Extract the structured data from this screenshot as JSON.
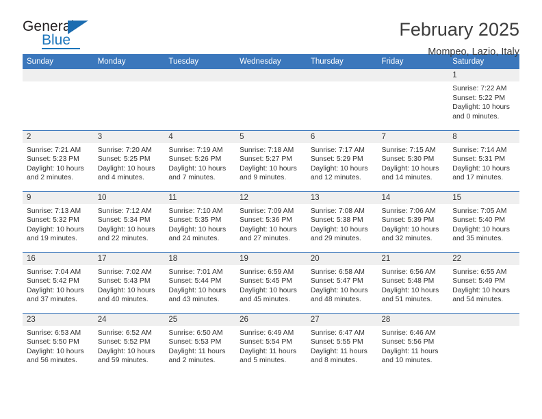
{
  "brand": {
    "name_top": "General",
    "name_bottom": "Blue",
    "accent_color": "#1b75bb",
    "triangle_icon": "triangle-icon"
  },
  "header": {
    "title": "February 2025",
    "location": "Mompeo, Lazio, Italy"
  },
  "theme": {
    "header_blue": "#3b77bc",
    "daynum_gray": "#efefef",
    "text": "#333333"
  },
  "weekday_headers": [
    "Sunday",
    "Monday",
    "Tuesday",
    "Wednesday",
    "Thursday",
    "Friday",
    "Saturday"
  ],
  "labels": {
    "sunrise": "Sunrise:",
    "sunset": "Sunset:",
    "daylight": "Daylight:"
  },
  "weeks": [
    [
      {
        "day": "",
        "blank": true
      },
      {
        "day": "",
        "blank": true
      },
      {
        "day": "",
        "blank": true
      },
      {
        "day": "",
        "blank": true
      },
      {
        "day": "",
        "blank": true
      },
      {
        "day": "",
        "blank": true
      },
      {
        "day": "1",
        "sunrise": "Sunrise: 7:22 AM",
        "sunset": "Sunset: 5:22 PM",
        "daylight": "Daylight: 10 hours and 0 minutes."
      }
    ],
    [
      {
        "day": "2",
        "sunrise": "Sunrise: 7:21 AM",
        "sunset": "Sunset: 5:23 PM",
        "daylight": "Daylight: 10 hours and 2 minutes."
      },
      {
        "day": "3",
        "sunrise": "Sunrise: 7:20 AM",
        "sunset": "Sunset: 5:25 PM",
        "daylight": "Daylight: 10 hours and 4 minutes."
      },
      {
        "day": "4",
        "sunrise": "Sunrise: 7:19 AM",
        "sunset": "Sunset: 5:26 PM",
        "daylight": "Daylight: 10 hours and 7 minutes."
      },
      {
        "day": "5",
        "sunrise": "Sunrise: 7:18 AM",
        "sunset": "Sunset: 5:27 PM",
        "daylight": "Daylight: 10 hours and 9 minutes."
      },
      {
        "day": "6",
        "sunrise": "Sunrise: 7:17 AM",
        "sunset": "Sunset: 5:29 PM",
        "daylight": "Daylight: 10 hours and 12 minutes."
      },
      {
        "day": "7",
        "sunrise": "Sunrise: 7:15 AM",
        "sunset": "Sunset: 5:30 PM",
        "daylight": "Daylight: 10 hours and 14 minutes."
      },
      {
        "day": "8",
        "sunrise": "Sunrise: 7:14 AM",
        "sunset": "Sunset: 5:31 PM",
        "daylight": "Daylight: 10 hours and 17 minutes."
      }
    ],
    [
      {
        "day": "9",
        "sunrise": "Sunrise: 7:13 AM",
        "sunset": "Sunset: 5:32 PM",
        "daylight": "Daylight: 10 hours and 19 minutes."
      },
      {
        "day": "10",
        "sunrise": "Sunrise: 7:12 AM",
        "sunset": "Sunset: 5:34 PM",
        "daylight": "Daylight: 10 hours and 22 minutes."
      },
      {
        "day": "11",
        "sunrise": "Sunrise: 7:10 AM",
        "sunset": "Sunset: 5:35 PM",
        "daylight": "Daylight: 10 hours and 24 minutes."
      },
      {
        "day": "12",
        "sunrise": "Sunrise: 7:09 AM",
        "sunset": "Sunset: 5:36 PM",
        "daylight": "Daylight: 10 hours and 27 minutes."
      },
      {
        "day": "13",
        "sunrise": "Sunrise: 7:08 AM",
        "sunset": "Sunset: 5:38 PM",
        "daylight": "Daylight: 10 hours and 29 minutes."
      },
      {
        "day": "14",
        "sunrise": "Sunrise: 7:06 AM",
        "sunset": "Sunset: 5:39 PM",
        "daylight": "Daylight: 10 hours and 32 minutes."
      },
      {
        "day": "15",
        "sunrise": "Sunrise: 7:05 AM",
        "sunset": "Sunset: 5:40 PM",
        "daylight": "Daylight: 10 hours and 35 minutes."
      }
    ],
    [
      {
        "day": "16",
        "sunrise": "Sunrise: 7:04 AM",
        "sunset": "Sunset: 5:42 PM",
        "daylight": "Daylight: 10 hours and 37 minutes."
      },
      {
        "day": "17",
        "sunrise": "Sunrise: 7:02 AM",
        "sunset": "Sunset: 5:43 PM",
        "daylight": "Daylight: 10 hours and 40 minutes."
      },
      {
        "day": "18",
        "sunrise": "Sunrise: 7:01 AM",
        "sunset": "Sunset: 5:44 PM",
        "daylight": "Daylight: 10 hours and 43 minutes."
      },
      {
        "day": "19",
        "sunrise": "Sunrise: 6:59 AM",
        "sunset": "Sunset: 5:45 PM",
        "daylight": "Daylight: 10 hours and 45 minutes."
      },
      {
        "day": "20",
        "sunrise": "Sunrise: 6:58 AM",
        "sunset": "Sunset: 5:47 PM",
        "daylight": "Daylight: 10 hours and 48 minutes."
      },
      {
        "day": "21",
        "sunrise": "Sunrise: 6:56 AM",
        "sunset": "Sunset: 5:48 PM",
        "daylight": "Daylight: 10 hours and 51 minutes."
      },
      {
        "day": "22",
        "sunrise": "Sunrise: 6:55 AM",
        "sunset": "Sunset: 5:49 PM",
        "daylight": "Daylight: 10 hours and 54 minutes."
      }
    ],
    [
      {
        "day": "23",
        "sunrise": "Sunrise: 6:53 AM",
        "sunset": "Sunset: 5:50 PM",
        "daylight": "Daylight: 10 hours and 56 minutes."
      },
      {
        "day": "24",
        "sunrise": "Sunrise: 6:52 AM",
        "sunset": "Sunset: 5:52 PM",
        "daylight": "Daylight: 10 hours and 59 minutes."
      },
      {
        "day": "25",
        "sunrise": "Sunrise: 6:50 AM",
        "sunset": "Sunset: 5:53 PM",
        "daylight": "Daylight: 11 hours and 2 minutes."
      },
      {
        "day": "26",
        "sunrise": "Sunrise: 6:49 AM",
        "sunset": "Sunset: 5:54 PM",
        "daylight": "Daylight: 11 hours and 5 minutes."
      },
      {
        "day": "27",
        "sunrise": "Sunrise: 6:47 AM",
        "sunset": "Sunset: 5:55 PM",
        "daylight": "Daylight: 11 hours and 8 minutes."
      },
      {
        "day": "28",
        "sunrise": "Sunrise: 6:46 AM",
        "sunset": "Sunset: 5:56 PM",
        "daylight": "Daylight: 11 hours and 10 minutes."
      },
      {
        "day": "",
        "blank": true
      }
    ]
  ]
}
